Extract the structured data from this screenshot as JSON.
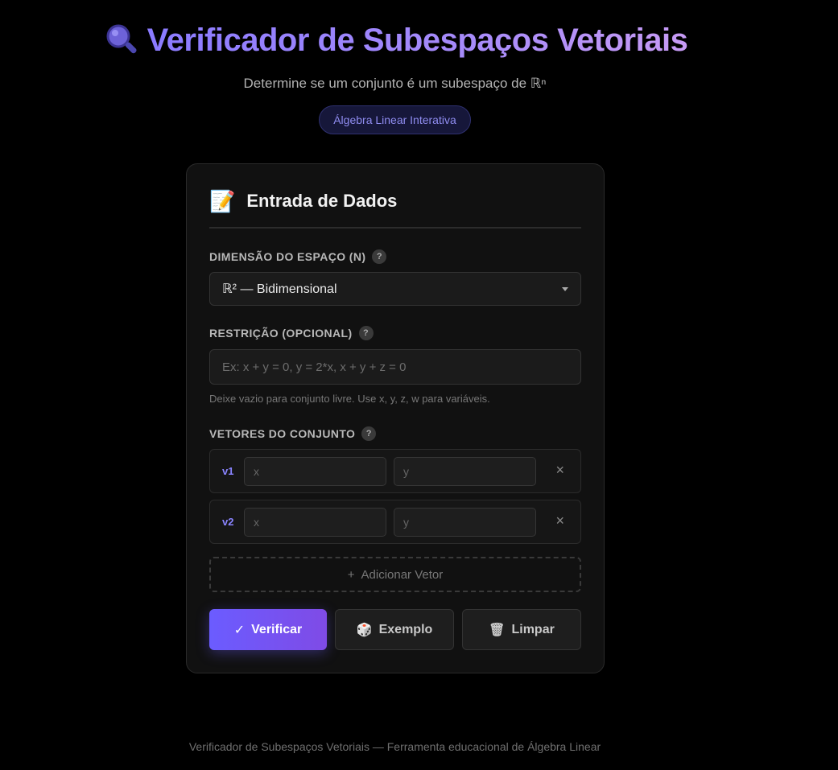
{
  "header": {
    "title": "Verificador de Subespaços Vetoriais",
    "title_icon": "magnifier-icon",
    "subtitle": "Determine se um conjunto é um subespaço de ℝⁿ",
    "badge": "Álgebra Linear Interativa"
  },
  "card": {
    "icon": "memo-icon",
    "title": "Entrada de Dados",
    "dimension": {
      "label": "DIMENSÃO DO ESPAÇO (N)",
      "help": "?",
      "selected": "ℝ² — Bidimensional"
    },
    "restriction": {
      "label": "RESTRIÇÃO (OPCIONAL)",
      "help": "?",
      "placeholder": "Ex: x + y = 0, y = 2*x, x + y + z = 0",
      "value": "",
      "hint": "Deixe vazio para conjunto livre. Use x, y, z, w para variáveis."
    },
    "vectors": {
      "label": "VETORES DO CONJUNTO",
      "help": "?",
      "items": [
        {
          "name": "v1",
          "x_placeholder": "x",
          "y_placeholder": "y",
          "remove": "×"
        },
        {
          "name": "v2",
          "x_placeholder": "x",
          "y_placeholder": "y",
          "remove": "×"
        }
      ],
      "add_label": "Adicionar Vetor",
      "add_icon": "+"
    },
    "buttons": {
      "verify": {
        "icon": "✓",
        "label": "Verificar"
      },
      "example": {
        "icon": "🎲",
        "label": "Exemplo"
      },
      "clear": {
        "icon": "🗑",
        "label": "Limpar"
      }
    }
  },
  "footer": "Verificador de Subespaços Vetoriais — Ferramenta educacional de Álgebra Linear",
  "colors": {
    "accent": "#6b5cff",
    "background": "#000000",
    "card": "#111111"
  }
}
